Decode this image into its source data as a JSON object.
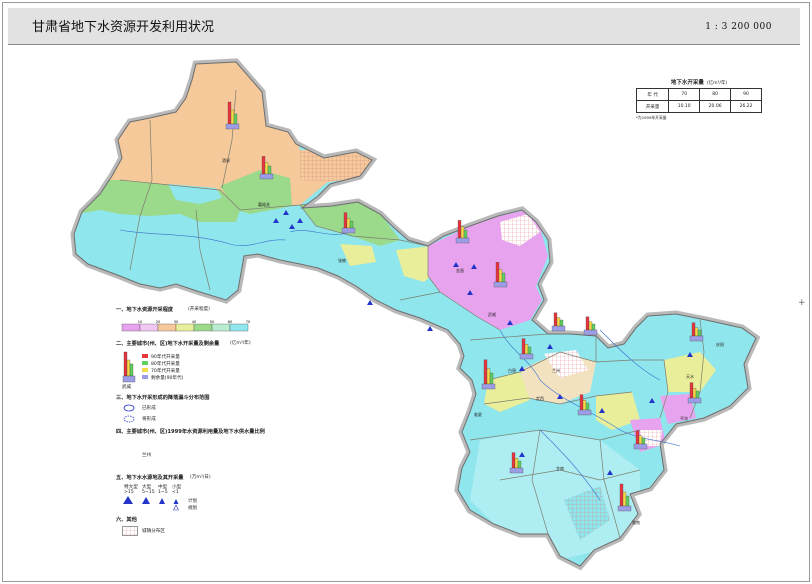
{
  "title": "甘肃省地下水资源开发利用状况",
  "scale": "1 : 3 200 000",
  "colors": {
    "sea": "#ffffff",
    "halo": "#b9b9b9",
    "border_prov": "#7a7a7a",
    "border_dist": "#7d7d6f",
    "peach": "#f5c99a",
    "green": "#9bd98b",
    "cyan": "#8fe6ec",
    "light_cyan": "#c9f1f5",
    "magenta": "#e8a3ee",
    "yellow": "#e8ee9a",
    "tan": "#f3e2c0",
    "river": "#3a6fd0",
    "bar_red": "#e8343c",
    "bar_yellow": "#f4d94a",
    "bar_green": "#5fcf5f",
    "bar_purple": "#9d9de6",
    "well": "#2235c8"
  },
  "table": {
    "title": "地下水开采量",
    "unit": "(亿m³/年)",
    "header": [
      "年 代",
      "70",
      "80",
      "90"
    ],
    "row": [
      "开采量",
      "10.10",
      "20.06",
      "26.22"
    ],
    "note": "*为1999年开采量"
  },
  "legend": {
    "s1_title": "一、地下水资源开采程度",
    "s1_unit": "(开采程度)",
    "s1_ticks": [
      "10",
      "20",
      "30",
      "40",
      "50",
      "60",
      "70",
      "80",
      "90"
    ],
    "s1_colors": [
      "#e8a3ee",
      "#f0c6f3",
      "#f5c99a",
      "#e8ee9a",
      "#9bd98b",
      "#b8ecd0",
      "#8fe6ec"
    ],
    "s2_title": "二、主要城市(州、区)地下水开采量及剩余量",
    "s2_unit": "(亿m³/年)",
    "s2_items": [
      "90年代开采量",
      "80年代开采量",
      "70年代开采量",
      "剩余量(90年代)"
    ],
    "s2_sample": "武威",
    "s3_title": "三、地下水开采形成的降落漏斗分布范围",
    "s3_items": [
      "已形成",
      "将形成"
    ],
    "s4_title": "四、主要城市(州、区)1999年水资源利用量及地下水供水量比例",
    "s4_item": "兰州",
    "s5_title": "五、地下水水源地及其开采量",
    "s5_unit": "(万m³/日)",
    "s5_cols": [
      "特大型",
      "大型",
      "中型",
      "小型"
    ],
    "s5_vals": [
      ">15",
      "5~15",
      "1~5",
      "<1"
    ],
    "s5_extra": [
      "计划",
      "规划"
    ],
    "s6_title": "六、其他",
    "s6_item": "城镇分布区"
  },
  "map_labels": [
    "酒泉",
    "嘉峪关",
    "张掖",
    "金昌",
    "武威",
    "白银",
    "兰州",
    "临夏",
    "定西",
    "天水",
    "平凉",
    "庆阳",
    "陇南",
    "甘南"
  ]
}
